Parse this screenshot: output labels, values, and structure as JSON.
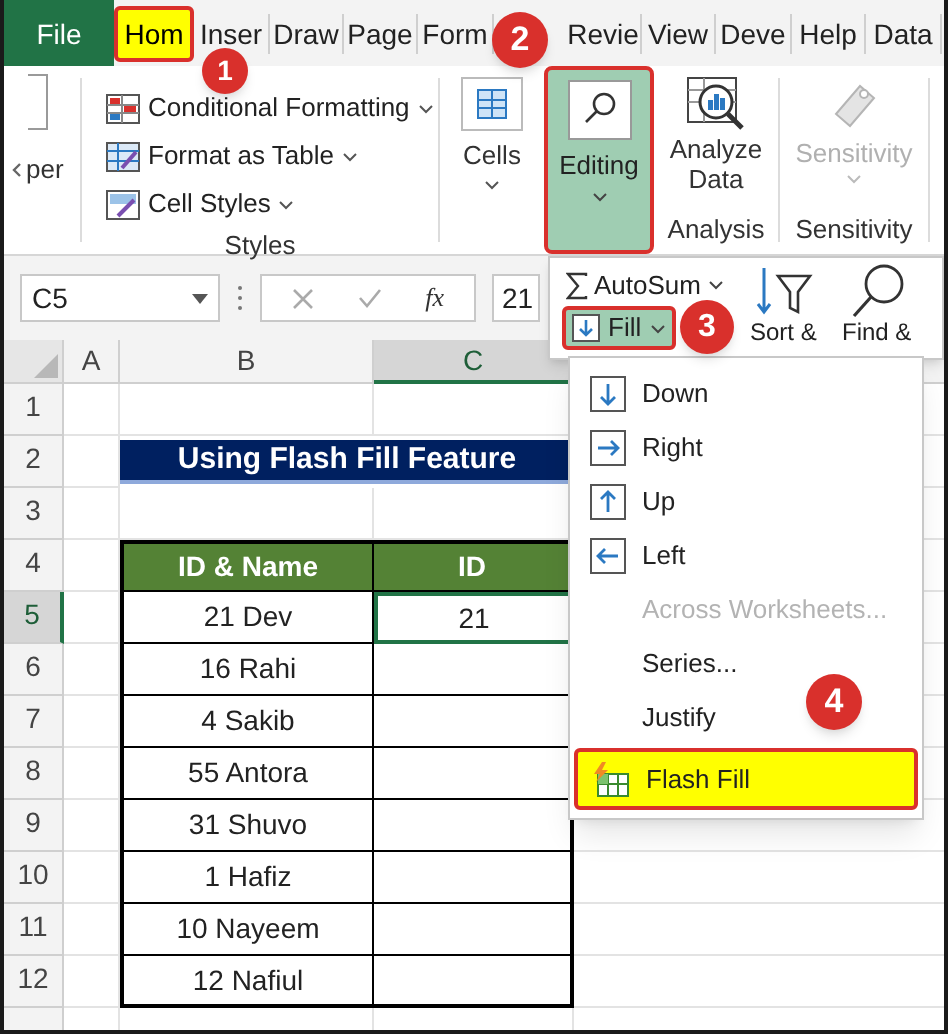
{
  "ribbon_tabs": [
    {
      "label": "File",
      "kind": "file",
      "selected": false
    },
    {
      "label": "Hom",
      "kind": "tab",
      "selected": true
    },
    {
      "label": "Inser",
      "kind": "tab",
      "selected": false
    },
    {
      "label": "Draw",
      "kind": "tab",
      "selected": false
    },
    {
      "label": "Page",
      "kind": "tab",
      "selected": false
    },
    {
      "label": "Form",
      "kind": "tab",
      "selected": false
    },
    {
      "label": "Revie",
      "kind": "tab",
      "selected": false
    },
    {
      "label": "View",
      "kind": "tab",
      "selected": false
    },
    {
      "label": "Deve",
      "kind": "tab",
      "selected": false
    },
    {
      "label": "Help",
      "kind": "tab",
      "selected": false
    },
    {
      "label": "Data",
      "kind": "tab",
      "selected": false
    }
  ],
  "ribbon": {
    "left_group_label": "per",
    "styles_items": [
      "Conditional Formatting",
      "Format as Table",
      "Cell Styles"
    ],
    "styles_label": "Styles",
    "cells_button": "Cells",
    "editing_button": {
      "label": "Editing",
      "highlighted": true
    },
    "analyze_button": [
      "Analyze",
      "Data"
    ],
    "analysis_label": "Analysis",
    "sensitivity_button": {
      "label": "Sensitivity",
      "disabled": true
    },
    "sensitivity_label": "Sensitivity"
  },
  "formula_bar": {
    "name_box": "C5",
    "function_label": "fx",
    "value": "21"
  },
  "editing_menu": {
    "autosum": "AutoSum",
    "fill": {
      "label": "Fill",
      "highlighted": true
    },
    "sort": "Sort &",
    "find": "Find &"
  },
  "fill_menu": [
    {
      "label": "Down",
      "kind": "down",
      "disabled": false,
      "highlighted": false
    },
    {
      "label": "Right",
      "kind": "right",
      "disabled": false,
      "highlighted": false
    },
    {
      "label": "Up",
      "kind": "up",
      "disabled": false,
      "highlighted": false
    },
    {
      "label": "Left",
      "kind": "left",
      "disabled": false,
      "highlighted": false
    },
    {
      "label": "Across Worksheets...",
      "kind": "plain",
      "disabled": true,
      "highlighted": false
    },
    {
      "label": "Series...",
      "kind": "plain",
      "disabled": false,
      "highlighted": false
    },
    {
      "label": "Justify",
      "kind": "plain",
      "disabled": false,
      "highlighted": false
    },
    {
      "label": "Flash Fill",
      "kind": "flash",
      "disabled": false,
      "highlighted": true
    }
  ],
  "sheet": {
    "columns": [
      {
        "label": "A",
        "selected": false
      },
      {
        "label": "B",
        "selected": false
      },
      {
        "label": "C",
        "selected": true
      }
    ],
    "rows": [
      {
        "number": "1",
        "selected": false
      },
      {
        "number": "2",
        "selected": false
      },
      {
        "number": "3",
        "selected": false
      },
      {
        "number": "4",
        "selected": false
      },
      {
        "number": "5",
        "selected": true
      },
      {
        "number": "6",
        "selected": false
      },
      {
        "number": "7",
        "selected": false
      },
      {
        "number": "8",
        "selected": false
      },
      {
        "number": "9",
        "selected": false
      },
      {
        "number": "10",
        "selected": false
      },
      {
        "number": "11",
        "selected": false
      },
      {
        "number": "12",
        "selected": false
      }
    ],
    "title": "Using Flash Fill Feature",
    "table": {
      "headers": [
        "ID & Name",
        "ID"
      ],
      "rows": [
        {
          "name": "21 Dev",
          "id": "21",
          "selected": true
        },
        {
          "name": "16 Rahi",
          "selected": false
        },
        {
          "name": "4 Sakib",
          "selected": false
        },
        {
          "name": "55 Antora",
          "selected": false
        },
        {
          "name": "31 Shuvo",
          "selected": false
        },
        {
          "name": "1 Hafiz",
          "selected": false
        },
        {
          "name": "10 Nayeem",
          "selected": false
        },
        {
          "name": "12 Nafiul",
          "selected": false
        }
      ]
    }
  },
  "callouts": [
    {
      "label": "1"
    },
    {
      "label": "2"
    },
    {
      "label": "3"
    },
    {
      "label": "4"
    }
  ]
}
